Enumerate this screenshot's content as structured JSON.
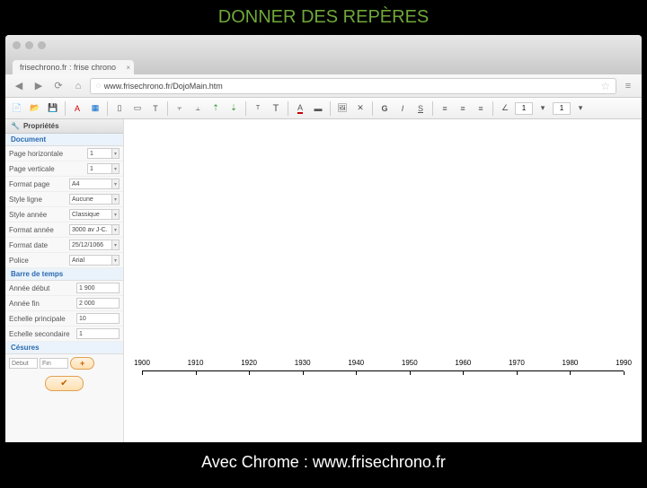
{
  "slide": {
    "title": "DONNER DES REPÈRES",
    "footer": "Avec Chrome :  www.frisechrono.fr"
  },
  "browser": {
    "tab_title": "frisechrono.fr : frise chrono",
    "url": "www.frisechrono.fr/DojoMain.htm"
  },
  "toolbar": {
    "size1": "1",
    "size2": "1"
  },
  "panel": {
    "title": "Propriétés",
    "sections": {
      "document": "Document",
      "barre": "Barre de temps",
      "cesures": "Césures"
    },
    "props": {
      "page_h_label": "Page horizontale",
      "page_h_val": "1",
      "page_v_label": "Page verticale",
      "page_v_val": "1",
      "format_page_label": "Format page",
      "format_page_val": "A4",
      "style_ligne_label": "Style ligne",
      "style_ligne_val": "Aucune",
      "style_annee_label": "Style année",
      "style_annee_val": "Classique",
      "format_annee_label": "Format année",
      "format_annee_val": "3000 av J-C.",
      "format_date_label": "Format date",
      "format_date_val": "25/12/1066",
      "police_label": "Police",
      "police_val": "Arial",
      "annee_debut_label": "Année début",
      "annee_debut_val": "1 900",
      "annee_fin_label": "Année fin",
      "annee_fin_val": "2 000",
      "echelle_p_label": "Echelle principale",
      "echelle_p_val": "10",
      "echelle_s_label": "Echelle secondaire",
      "echelle_s_val": "1"
    },
    "cesure": {
      "debut": "Début",
      "fin": "Fin",
      "add": "+",
      "apply": "✔"
    }
  },
  "timeline": {
    "ticks": [
      "1900",
      "1910",
      "1920",
      "1930",
      "1940",
      "1950",
      "1960",
      "1970",
      "1980",
      "1990"
    ]
  }
}
